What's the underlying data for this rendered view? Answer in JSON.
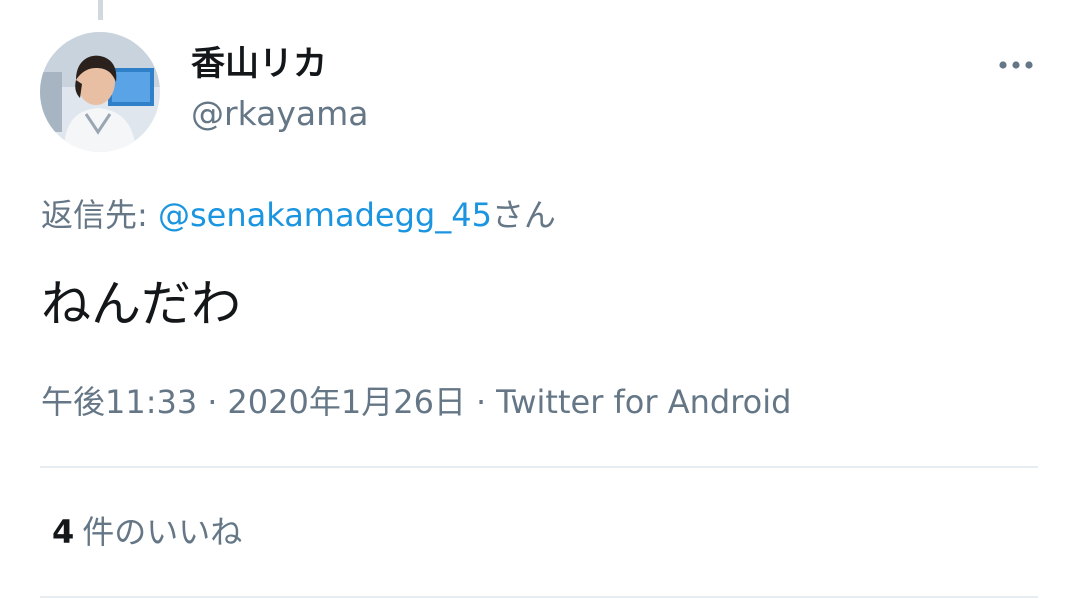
{
  "author": {
    "display_name": "香山リカ",
    "handle": "@rkayama",
    "avatar_icon": "avatar-photo"
  },
  "more_icon": "more-horizontal-icon",
  "reply": {
    "prefix": "返信先: ",
    "mention": "@senakamadegg_45",
    "suffix": "さん"
  },
  "tweet": {
    "text": "ねんだわ"
  },
  "meta": {
    "time": "午後11:33",
    "separator": "·",
    "date": "2020年1月26日",
    "source": "Twitter for Android"
  },
  "likes": {
    "count": "4",
    "label": "件のいいね"
  },
  "colors": {
    "text_primary": "#14171a",
    "text_secondary": "#657786",
    "link": "#1b95e0",
    "divider": "#e6ecf0"
  }
}
